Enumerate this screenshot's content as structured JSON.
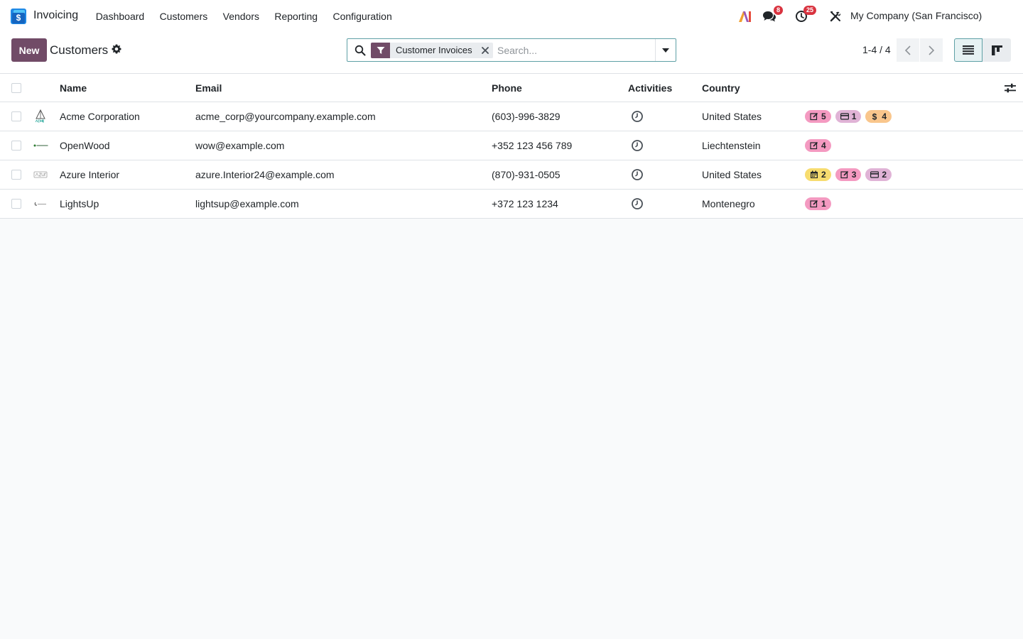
{
  "navbar": {
    "app_name": "Invoicing",
    "menu": [
      "Dashboard",
      "Customers",
      "Vendors",
      "Reporting",
      "Configuration"
    ],
    "messages_count": "8",
    "activities_count": "25",
    "company": "My Company (San Francisco)"
  },
  "control_panel": {
    "new_label": "New",
    "title": "Customers",
    "search": {
      "facet": "Customer Invoices",
      "placeholder": "Search..."
    },
    "pager": "1-4 / 4"
  },
  "table": {
    "columns": [
      "Name",
      "Email",
      "Phone",
      "Activities",
      "Country"
    ],
    "rows": [
      {
        "name": "Acme Corporation",
        "email": "acme_corp@yourcompany.example.com",
        "phone": "(603)-996-3829",
        "country": "United States",
        "avatar": "acme-logo",
        "tags": [
          {
            "icon": "pencil-square-icon",
            "value": "5",
            "color": "#f49ac1"
          },
          {
            "icon": "credit-card-icon",
            "value": "1",
            "color": "#e0b3d6"
          },
          {
            "icon": "dollar-icon",
            "value": "4",
            "color": "#f9c68c"
          }
        ]
      },
      {
        "name": "OpenWood",
        "email": "wow@example.com",
        "phone": "+352 123 456 789",
        "country": "Liechtenstein",
        "avatar": "openwood-logo",
        "tags": [
          {
            "icon": "pencil-square-icon",
            "value": "4",
            "color": "#f49ac1"
          }
        ]
      },
      {
        "name": "Azure Interior",
        "email": "azure.Interior24@example.com",
        "phone": "(870)-931-0505",
        "country": "United States",
        "avatar": "azure-logo",
        "tags": [
          {
            "icon": "calendar-icon",
            "value": "2",
            "color": "#f7dc6f"
          },
          {
            "icon": "pencil-square-icon",
            "value": "3",
            "color": "#f49ac1"
          },
          {
            "icon": "credit-card-icon",
            "value": "2",
            "color": "#e0b3d6"
          }
        ]
      },
      {
        "name": "LightsUp",
        "email": "lightsup@example.com",
        "phone": "+372 123 1234",
        "country": "Montenegro",
        "avatar": "lightsup-logo",
        "tags": [
          {
            "icon": "pencil-square-icon",
            "value": "1",
            "color": "#f49ac1"
          }
        ]
      }
    ]
  },
  "colors": {
    "brand": "#714b67",
    "badge": "#d9333f",
    "search_border": "#5fa0a6"
  }
}
